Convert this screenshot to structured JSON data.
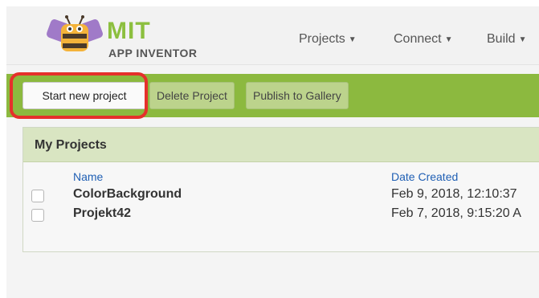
{
  "brand": {
    "name": "MIT",
    "subtitle": "APP INVENTOR",
    "logo_icon": "bee-logo-icon",
    "accent_color": "#8cbf3f"
  },
  "menu": {
    "projects": "Projects",
    "connect": "Connect",
    "build": "Build"
  },
  "toolbar": {
    "start_new_project": "Start new project",
    "delete_project": "Delete Project",
    "publish_to_gallery": "Publish to Gallery",
    "bar_color": "#8cb93f",
    "highlight_color": "#e5302b"
  },
  "projects_panel": {
    "title": "My Projects",
    "columns": {
      "name": "Name",
      "date_created": "Date Created"
    },
    "rows": [
      {
        "name": "ColorBackground",
        "date_created": "Feb 9, 2018, 12:10:37"
      },
      {
        "name": "Projekt42",
        "date_created": "Feb 7, 2018, 9:15:20 A"
      }
    ]
  }
}
